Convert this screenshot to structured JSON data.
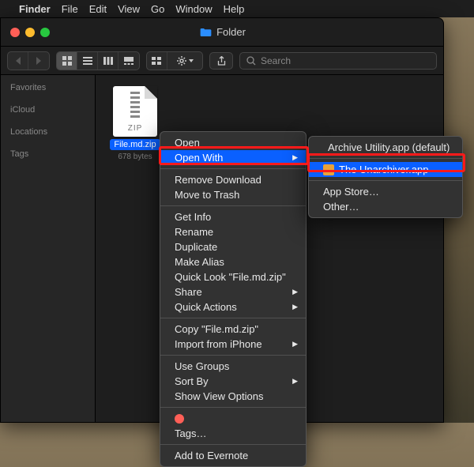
{
  "menubar": {
    "app": "Finder",
    "items": [
      "File",
      "Edit",
      "View",
      "Go",
      "Window",
      "Help"
    ]
  },
  "window": {
    "title": "Folder"
  },
  "search": {
    "placeholder": "Search"
  },
  "sidebar": {
    "sections": [
      "Favorites",
      "iCloud",
      "Locations",
      "Tags"
    ]
  },
  "file": {
    "name": "File.md.zip",
    "meta": "678 bytes",
    "badge": "ZIP"
  },
  "context_menu": {
    "open": "Open",
    "open_with": "Open With",
    "remove_download": "Remove Download",
    "move_to_trash": "Move to Trash",
    "get_info": "Get Info",
    "rename": "Rename",
    "duplicate": "Duplicate",
    "make_alias": "Make Alias",
    "quick_look": "Quick Look \"File.md.zip\"",
    "share": "Share",
    "quick_actions": "Quick Actions",
    "copy": "Copy \"File.md.zip\"",
    "import_iphone": "Import from iPhone",
    "use_groups": "Use Groups",
    "sort_by": "Sort By",
    "show_view_options": "Show View Options",
    "tags": "Tags…",
    "add_evernote": "Add to Evernote"
  },
  "open_with_menu": {
    "archive_utility": "Archive Utility.app (default)",
    "the_unarchiver": "The Unarchiver.app",
    "app_store": "App Store…",
    "other": "Other…"
  }
}
